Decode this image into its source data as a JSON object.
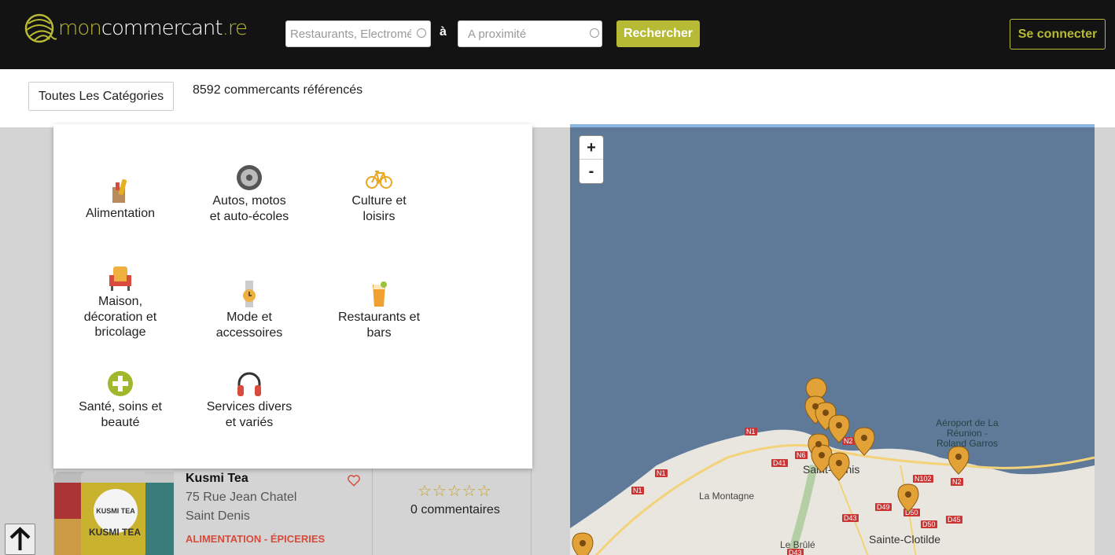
{
  "header": {
    "logo_part1": "mon",
    "logo_part2": "commercant",
    "logo_part3": ".re",
    "search_what_placeholder": "Restaurants, Electroménager...",
    "separator": "à",
    "search_where_placeholder": "A proximité",
    "search_button": "Rechercher",
    "login_button": "Se connecter",
    "accent_color": "#b6ba34"
  },
  "subbar": {
    "category_button": "Toutes Les Catégories",
    "count_text": "8592 commercants référencés"
  },
  "categories": [
    {
      "label_lines": [
        "Alimentation"
      ],
      "icon": "grocery-bag-icon"
    },
    {
      "label_lines": [
        "Autos, motos",
        "et auto-écoles"
      ],
      "icon": "wheel-icon"
    },
    {
      "label_lines": [
        "Culture et",
        "loisirs"
      ],
      "icon": "bicycle-icon"
    },
    {
      "label_lines": [
        "Maison,",
        "décoration et",
        "bricolage"
      ],
      "icon": "armchair-icon"
    },
    {
      "label_lines": [
        "Mode et",
        "accessoires"
      ],
      "icon": "watch-icon"
    },
    {
      "label_lines": [
        "Restaurants et",
        "bars"
      ],
      "icon": "drink-glass-icon"
    },
    {
      "label_lines": [
        "Santé, soins et",
        "beauté"
      ],
      "icon": "health-cross-icon"
    },
    {
      "label_lines": [
        "Services divers",
        "et variés"
      ],
      "icon": "headphones-icon"
    }
  ],
  "listing": {
    "name": "Kusmi Tea",
    "address": "75 Rue Jean Chatel",
    "city": "Saint Denis",
    "category": "ALIMENTATION - ÉPICERIES",
    "rating_stars": "☆☆☆☆☆",
    "comments": "0 commentaires",
    "image_brand": "KUSMI TEA"
  },
  "map": {
    "zoom_in": "+",
    "zoom_out": "-",
    "labels": {
      "saint_denis": "Saint-Denis",
      "la_montagne": "La Montagne",
      "sainte_clotilde": "Sainte-Clotilde",
      "le_brule": "Le Brûlé",
      "airport": "Aéroport de La Réunion - Roland Garros"
    },
    "roads": [
      "N1",
      "N6",
      "N2",
      "D41",
      "N1",
      "N1",
      "N102",
      "N2",
      "D49",
      "D50",
      "D50",
      "D45",
      "D43",
      "D43"
    ]
  }
}
